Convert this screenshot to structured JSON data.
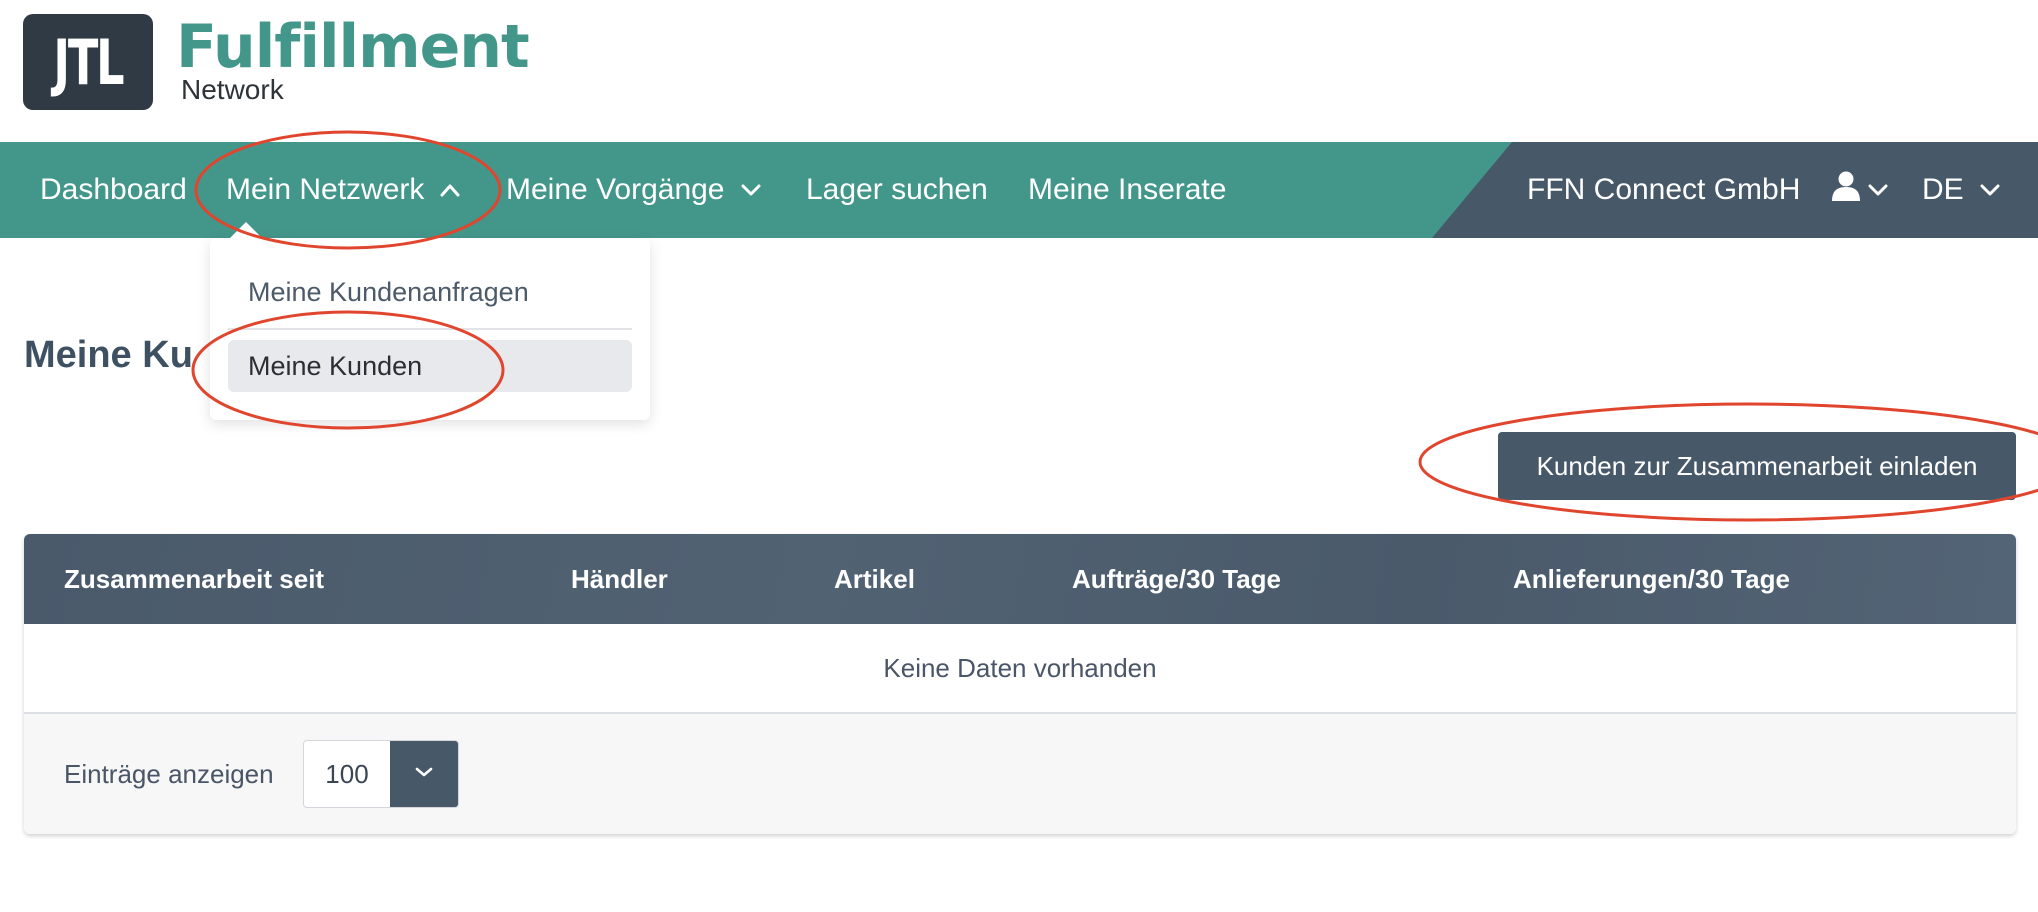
{
  "brand": {
    "logo_text": "JTL",
    "title": "Fulfillment",
    "subtitle": "Network"
  },
  "nav": {
    "items": [
      {
        "label": "Dashboard",
        "has_chevron": false
      },
      {
        "label": "Mein Netzwerk",
        "has_chevron": true,
        "chevron": "chevron-up-icon"
      },
      {
        "label": "Meine Vorgänge",
        "has_chevron": true,
        "chevron": "chevron-down-icon"
      },
      {
        "label": "Lager suchen",
        "has_chevron": false
      },
      {
        "label": "Meine Inserate",
        "has_chevron": false
      }
    ],
    "company": "FFN Connect GmbH",
    "user_icon": "user-icon",
    "language": "DE"
  },
  "dropdown": {
    "items": [
      {
        "label": "Meine Kundenanfragen",
        "active": false
      },
      {
        "label": "Meine Kunden",
        "active": true
      }
    ]
  },
  "page": {
    "title_visible": "Meine Ku"
  },
  "actions": {
    "invite_label": "Kunden zur Zusammenarbeit einladen"
  },
  "table": {
    "headers": [
      "Zusammenarbeit seit",
      "Händler",
      "Artikel",
      "Aufträge/30 Tage",
      "Anlieferungen/30 Tage"
    ],
    "empty_text": "Keine Daten vorhanden",
    "footer": {
      "entries_label": "Einträge anzeigen",
      "entries_value": "100"
    }
  },
  "colors": {
    "brand_teal": "#43978a",
    "navy": "#475869",
    "annotation_red": "#e0452e"
  }
}
